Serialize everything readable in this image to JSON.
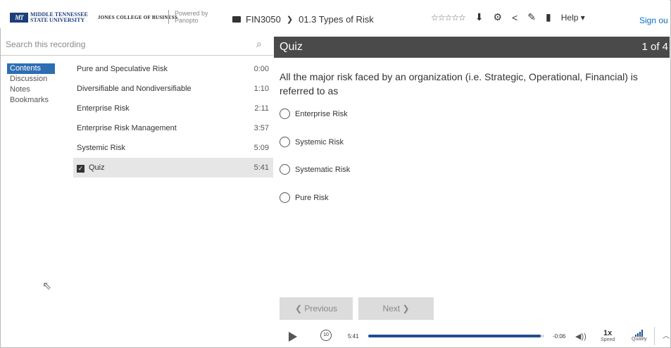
{
  "header": {
    "logo_mark": "MT",
    "university": [
      "MIDDLE TENNESSEE",
      "STATE UNIVERSITY"
    ],
    "college": "JONES COLLEGE OF BUSINESS",
    "powered_by": [
      "Powered by",
      "Panopto"
    ],
    "breadcrumb_folder": "FIN3050",
    "breadcrumb_session": "01.3 Types of Risk",
    "rating_stars": "☆☆☆☆☆",
    "help_label": "Help ▾",
    "signout_label": "Sign ou",
    "icons": [
      "folder-icon",
      "download-icon",
      "gear-icon",
      "share-icon",
      "pencil-icon",
      "stats-icon"
    ]
  },
  "search": {
    "placeholder": "Search this recording"
  },
  "nav": {
    "items": [
      {
        "label": "Contents",
        "active": true
      },
      {
        "label": "Discussion"
      },
      {
        "label": "Notes"
      },
      {
        "label": "Bookmarks"
      }
    ]
  },
  "toc": {
    "rows": [
      {
        "title": "Pure and Speculative Risk",
        "time": "0:00"
      },
      {
        "title": "Diversifiable and Nondiversifiable",
        "time": "1:10"
      },
      {
        "title": "Enterprise Risk",
        "time": "2:11"
      },
      {
        "title": "Enterprise Risk Management",
        "time": "3:57"
      },
      {
        "title": "Systemic Risk",
        "time": "5:09"
      },
      {
        "title": "Quiz",
        "time": "5:41",
        "selected": true
      }
    ]
  },
  "quiz": {
    "title": "Quiz",
    "counter": "1 of 4",
    "question": "All the major risk faced by an organization (i.e. Strategic, Operational, Financial) is referred to as",
    "options": [
      "Enterprise Risk",
      "Systemic Risk",
      "Systematic Risk",
      "Pure Risk"
    ],
    "previous_label": "❮  Previous",
    "next_label": "Next  ❯"
  },
  "player": {
    "rewind_label": "10",
    "current_time": "5:41",
    "remaining_time": "-0:06",
    "progress": 0.98,
    "speed_value": "1x",
    "speed_label": "Speed",
    "quality_label": "Quality"
  },
  "colors": {
    "accent": "#2e6db4",
    "progress": "#1d4f91",
    "quiz_header": "#4a4a4a",
    "link": "#0a6fc2"
  }
}
